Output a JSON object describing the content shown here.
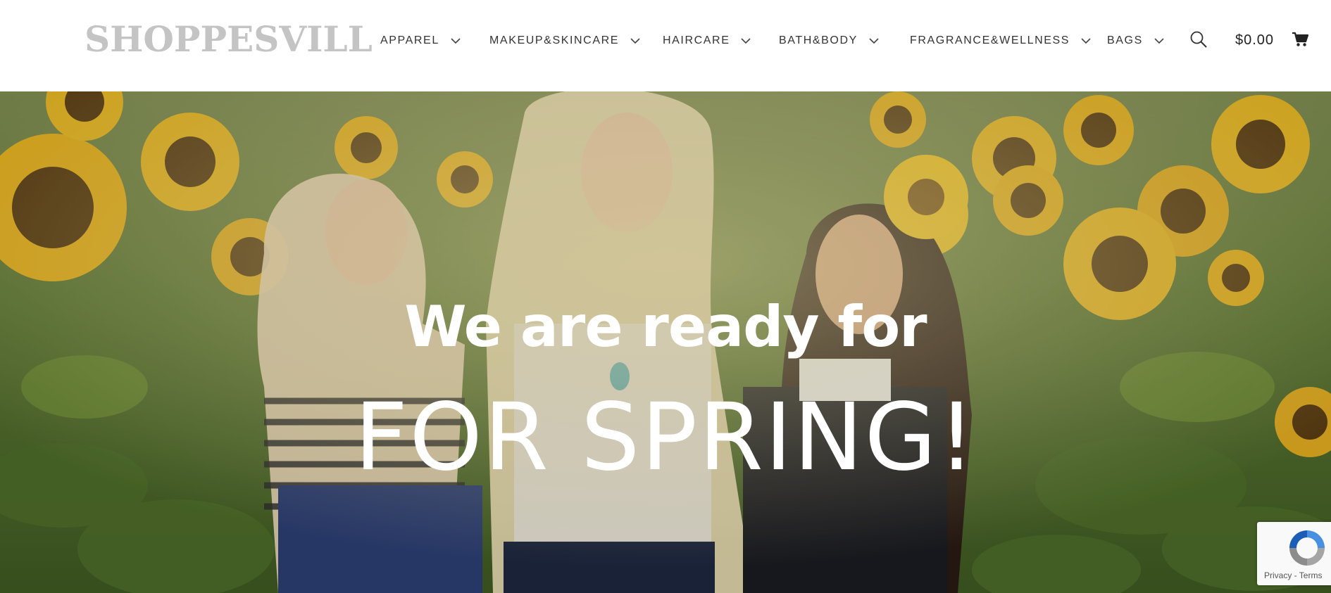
{
  "header": {
    "logo": "SHOPPESVILL",
    "nav": [
      {
        "label": "APPAREL"
      },
      {
        "label": "MAKEUP&SKINCARE"
      },
      {
        "label": "HAIRCARE"
      },
      {
        "label": "BATH&BODY"
      },
      {
        "label": "FRAGRANCE&WELLNESS"
      },
      {
        "label": "BAGS"
      }
    ],
    "search_icon": "search-icon",
    "cart_total": "$0.00",
    "cart_icon": "shopping-cart-icon"
  },
  "hero": {
    "line1": "We are ready for",
    "line2": "FOR SPRING!",
    "image_description_icon": "sunflower-field-photo"
  },
  "recaptcha": {
    "privacy": "Privacy",
    "separator": " - ",
    "terms": "Terms"
  },
  "colors": {
    "logo": "#c4c4c4",
    "nav_text": "#333333",
    "hero_text": "#ffffff"
  }
}
